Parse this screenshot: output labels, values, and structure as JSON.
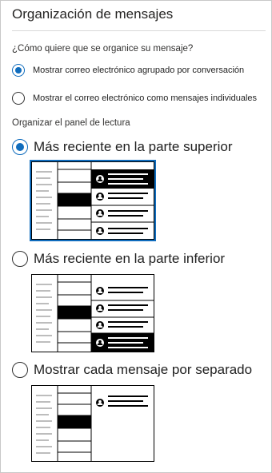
{
  "panel": {
    "title": "Organización de mensajes",
    "question": "¿Cómo quiere que se organice su mensaje?",
    "reading_pane_label": "Organizar el panel de lectura"
  },
  "grouping": {
    "selected": "conversation",
    "options": [
      {
        "id": "conversation",
        "label": "Mostrar correo electrónico agrupado por conversación"
      },
      {
        "id": "individual",
        "label": "Mostrar el correo electrónico como mensajes individuales"
      }
    ]
  },
  "reading_pane": {
    "selected": "newest_top",
    "options": [
      {
        "id": "newest_top",
        "label": "Más reciente en la parte superior",
        "preview_icon": "newest-on-top-layout"
      },
      {
        "id": "newest_bottom",
        "label": "Más reciente en la parte inferior",
        "preview_icon": "newest-on-bottom-layout"
      },
      {
        "id": "separate",
        "label": "Mostrar cada mensaje por separado",
        "preview_icon": "separate-messages-layout"
      }
    ]
  },
  "colors": {
    "accent": "#0f6cbd",
    "ink": "#000000",
    "border": "#c8c8c8"
  }
}
